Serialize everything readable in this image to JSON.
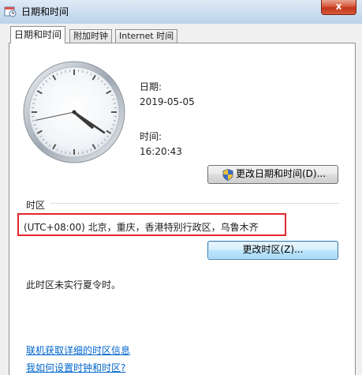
{
  "window": {
    "title": "日期和时间",
    "close_label": "x"
  },
  "tabs": [
    {
      "label": "日期和时间",
      "active": true
    },
    {
      "label": "附加时钟",
      "active": false
    },
    {
      "label": "Internet 时间",
      "active": false
    }
  ],
  "datetime": {
    "date_label": "日期:",
    "date_value": "2019-05-05",
    "time_label": "时间:",
    "time_value": "16:20:43",
    "change_button": "更改日期和时间(D)..."
  },
  "clock": {
    "hour": 16,
    "minute": 20,
    "second": 43
  },
  "timezone": {
    "section_label": "时区",
    "value": "(UTC+08:00) 北京，重庆，香港特别行政区，乌鲁木齐",
    "change_button": "更改时区(Z)...",
    "dst_note": "此时区未实行夏令时。"
  },
  "links": {
    "online_info": "联机获取详细的时区信息",
    "how_to_set": "我如何设置时钟和时区?"
  },
  "colors": {
    "highlight_border": "#e2262b",
    "link": "#0066cc"
  }
}
